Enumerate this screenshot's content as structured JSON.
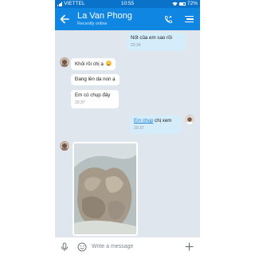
{
  "status_bar": {
    "carrier": "VIETTEL",
    "time": "10:55",
    "battery": "72%"
  },
  "header": {
    "contact_name": "La Van Phong",
    "contact_status": "Recently online"
  },
  "messages": [
    {
      "direction": "outgoing",
      "text": "Nốt của em sao rồi",
      "time": "20:34"
    },
    {
      "direction": "incoming",
      "text": "Khỏi rồi chị ạ",
      "emoji": "smiley"
    },
    {
      "direction": "incoming",
      "text": "Đang lên da non ạ"
    },
    {
      "direction": "incoming",
      "text": "Em có chụp đây",
      "time": "20:37"
    },
    {
      "direction": "outgoing",
      "link_text": "Em chụp",
      "text": " chị xem",
      "time": "20:37"
    },
    {
      "direction": "incoming",
      "type": "image"
    }
  ],
  "input": {
    "placeholder": "Write a message"
  },
  "colors": {
    "header_blue": "#0f86e1",
    "statusbar_blue": "#0a73c9",
    "chat_background": "#dfe6ee",
    "outgoing_bubble": "#d5ecfb",
    "incoming_bubble": "#ffffff",
    "link": "#1a7fd6"
  },
  "icons": {
    "back": "arrow-left-icon",
    "call": "phone-icon",
    "menu": "menu-icon",
    "mic": "microphone-icon",
    "sticker": "smiley-icon",
    "add": "plus-icon"
  }
}
